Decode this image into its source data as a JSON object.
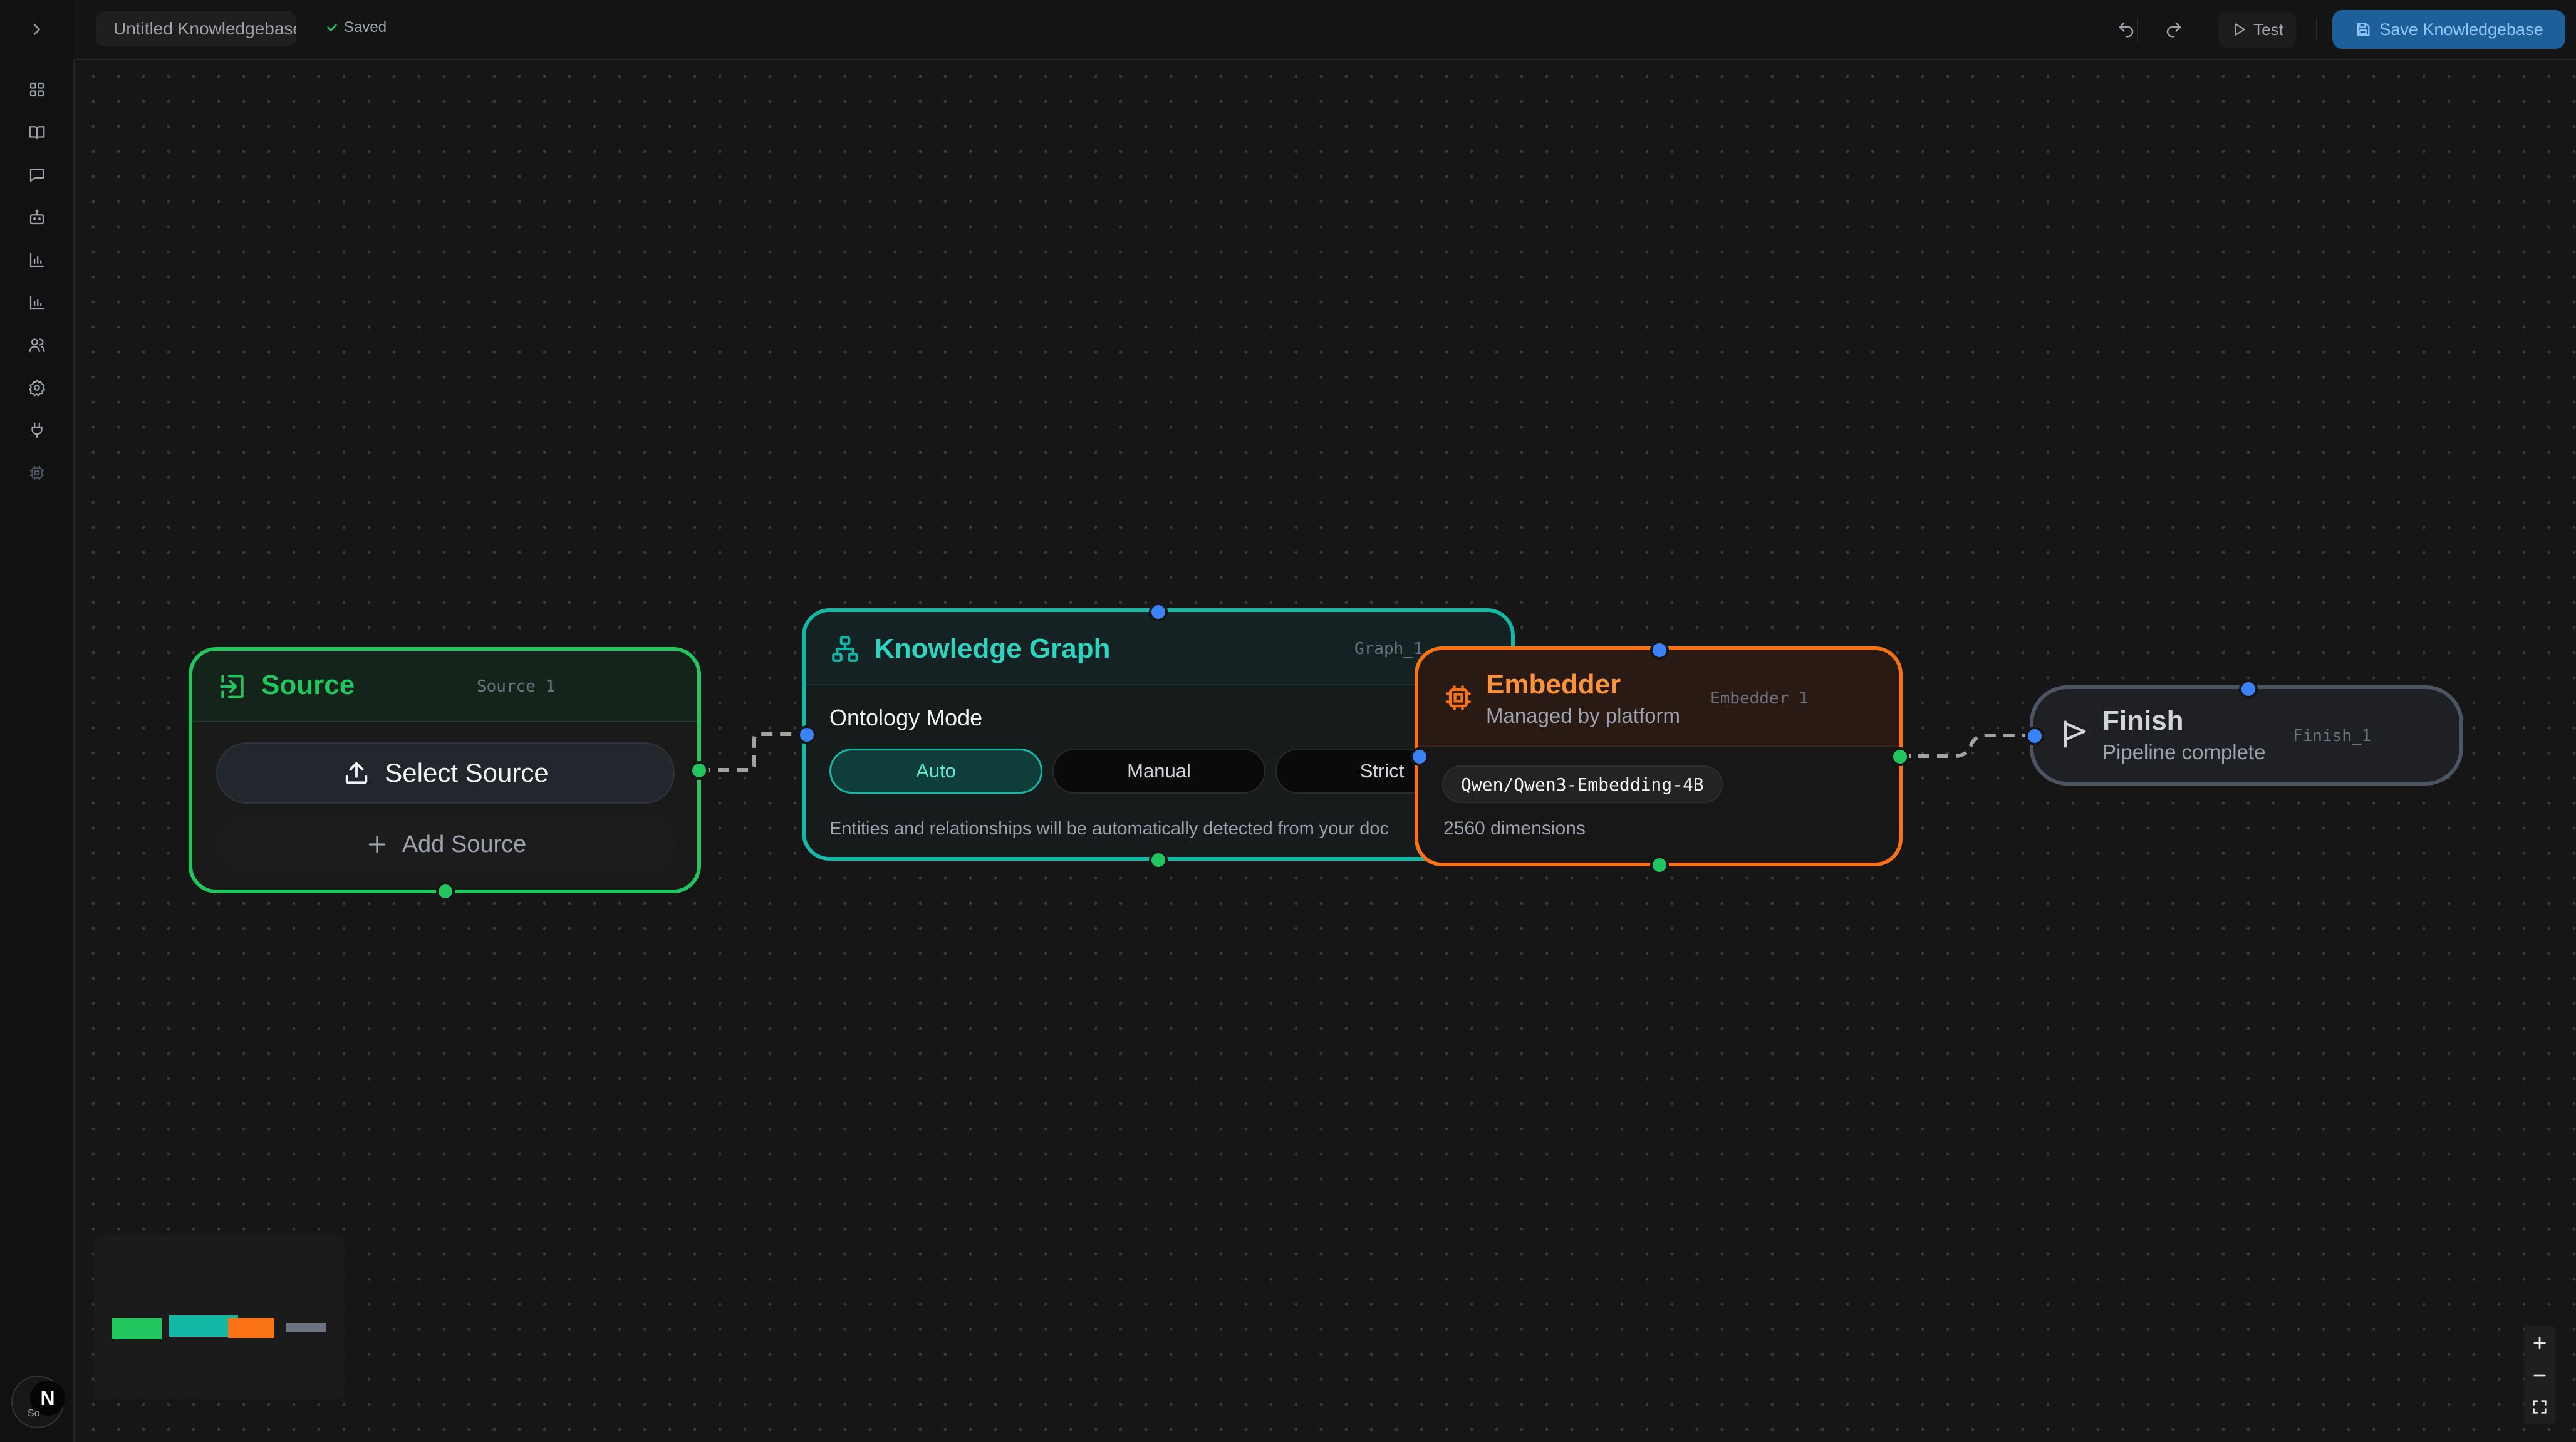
{
  "topbar": {
    "title_value": "Untitled Knowledgebase",
    "saved_label": "Saved",
    "test_label": "Test",
    "save_label": "Save Knowledgebase"
  },
  "sidebar": {
    "items": [
      {
        "icon": "layout-grid-icon"
      },
      {
        "icon": "book-open-icon"
      },
      {
        "icon": "message-square-icon"
      },
      {
        "icon": "bot-icon"
      },
      {
        "icon": "bar-chart-icon"
      },
      {
        "icon": "bar-chart-icon"
      },
      {
        "icon": "users-icon"
      },
      {
        "icon": "settings-icon"
      },
      {
        "icon": "plug-icon"
      },
      {
        "icon": "chip-icon"
      }
    ],
    "avatar_initial": "N",
    "avatar_sub": "So"
  },
  "nodes": {
    "source": {
      "title": "Source",
      "id": "Source_1",
      "select_label": "Select Source",
      "add_label": "Add Source",
      "color": "#22c55e"
    },
    "graph": {
      "title": "Knowledge Graph",
      "id": "Graph_1",
      "ontology_label": "Ontology Mode",
      "modes": [
        "Auto",
        "Manual",
        "Strict"
      ],
      "selected_mode": "Auto",
      "description": "Entities and relationships will be automatically detected from your doc",
      "color": "#14b8a6"
    },
    "embedder": {
      "title": "Embedder",
      "subtitle": "Managed by platform",
      "id": "Embedder_1",
      "model": "Qwen/Qwen3-Embedding-4B",
      "dimensions": "2560 dimensions",
      "color": "#f97316"
    },
    "finish": {
      "title": "Finish",
      "subtitle": "Pipeline complete",
      "id": "Finish_1",
      "color": "#4b5563"
    }
  },
  "zoom_controls": [
    "zoom-in",
    "zoom-out",
    "fit-view"
  ]
}
